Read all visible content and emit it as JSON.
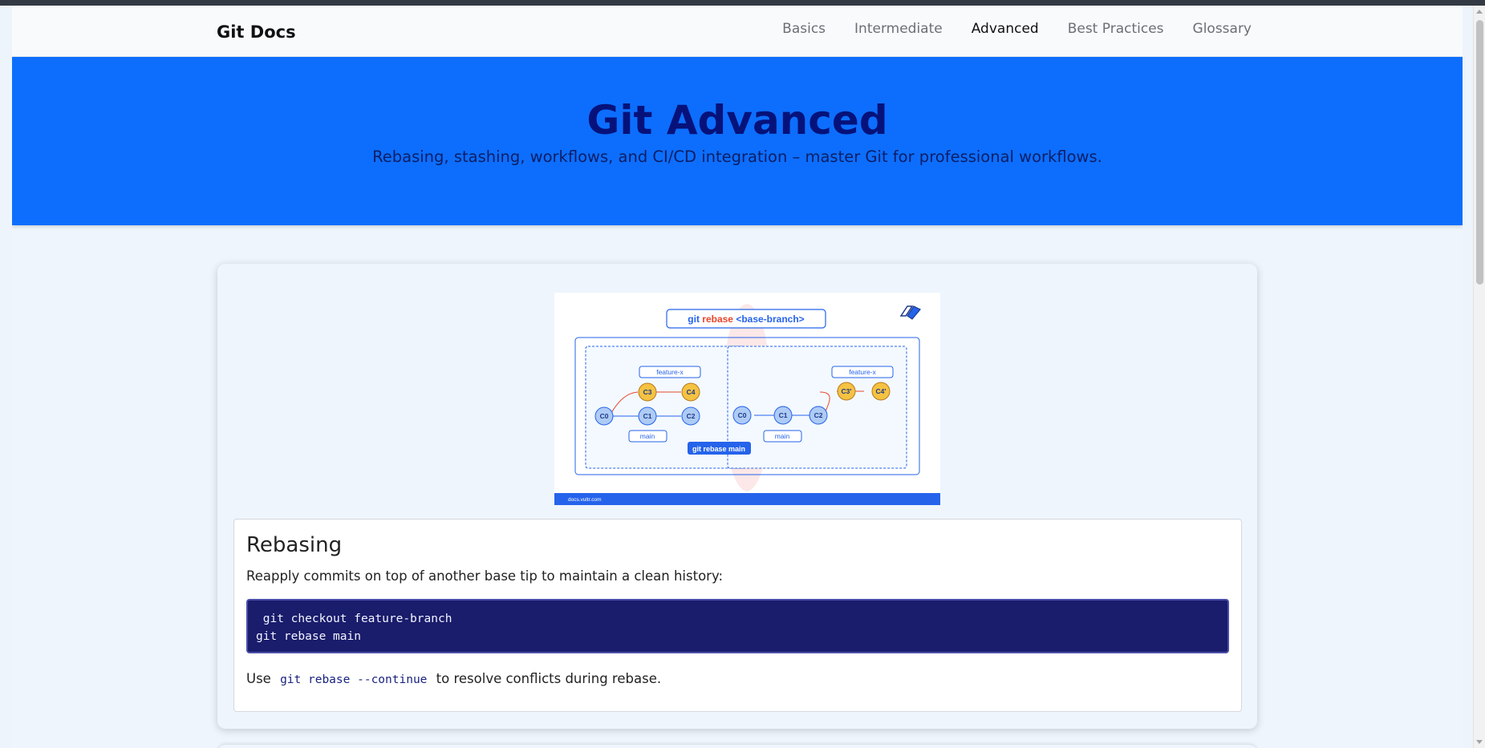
{
  "navbar": {
    "brand": "Git Docs",
    "links": [
      {
        "label": "Basics",
        "active": false
      },
      {
        "label": "Intermediate",
        "active": false
      },
      {
        "label": "Advanced",
        "active": true
      },
      {
        "label": "Best Practices",
        "active": false
      },
      {
        "label": "Glossary",
        "active": false
      }
    ]
  },
  "hero": {
    "title": "Git Advanced",
    "subtitle": "Rebasing, stashing, workflows, and CI/CD integration – master Git for professional workflows."
  },
  "figure": {
    "command_prefix": "git ",
    "command_keyword": "rebase",
    "command_arg": " <base-branch>",
    "left_branch_label": "feature-x",
    "left_main_label": "main",
    "right_branch_label": "feature-x",
    "right_main_label": "main",
    "action_label": "git rebase main",
    "footer_text": "docs.vultr.com",
    "left_commits": [
      "C0",
      "C1",
      "C2",
      "C3",
      "C4"
    ],
    "right_commits": [
      "C0",
      "C1",
      "C2",
      "C3'",
      "C4'"
    ],
    "colors": {
      "base": "#aecbf5",
      "feature": "#f5c242",
      "accent": "#2563eb",
      "keyword": "#e8452c"
    }
  },
  "section": {
    "title": "Rebasing",
    "description": "Reapply commits on top of another base tip to maintain a clean history:",
    "code_lines": [
      " git checkout feature-branch",
      "git rebase main"
    ],
    "note_prefix": "Use",
    "note_code": "git rebase --continue",
    "note_suffix": "to resolve conflicts during rebase."
  }
}
